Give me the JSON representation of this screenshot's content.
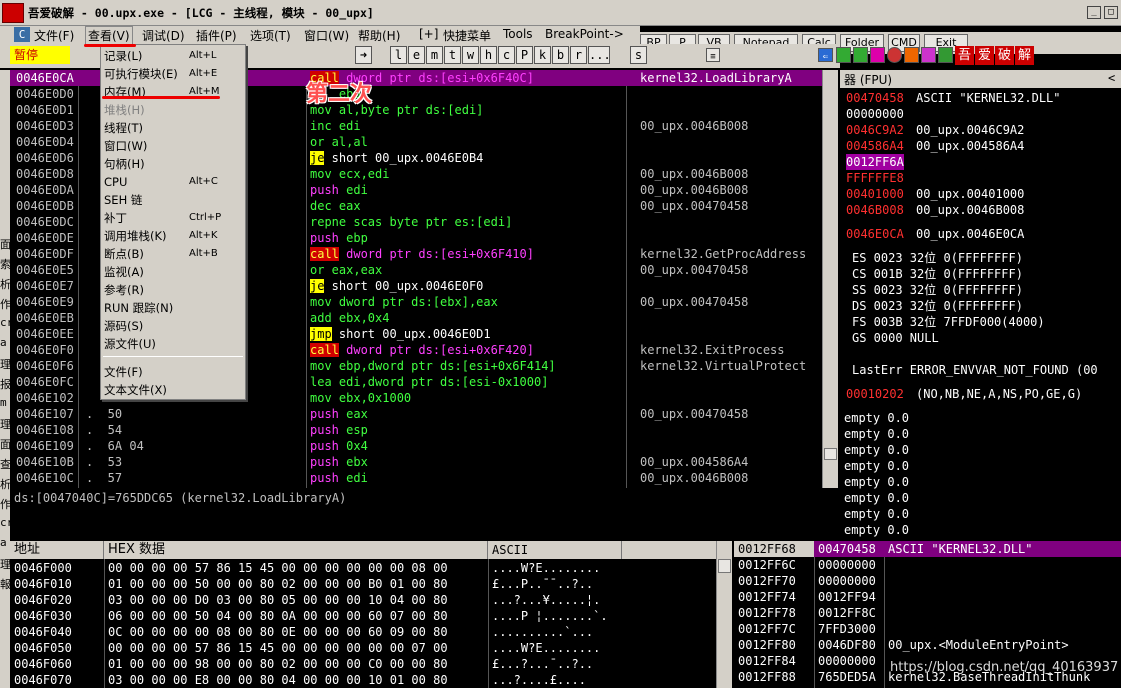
{
  "window": {
    "title": "吾爱破解 - 00.upx.exe - [LCG - 主线程, 模块 - 00_upx]"
  },
  "menubar": {
    "items": [
      "文件(F)",
      "查看(V)",
      "调试(D)",
      "插件(P)",
      "选项(T)",
      "窗口(W)",
      "帮助(H)",
      "[+]",
      "快捷菜单",
      "Tools",
      "BreakPoint->"
    ]
  },
  "toolbar": {
    "letters": [
      "l",
      "e",
      "m",
      "t",
      "w",
      "h",
      "c",
      "P",
      "k",
      "b",
      "r",
      "...",
      "s"
    ]
  },
  "right_buttons": [
    "BP",
    "P",
    "VB",
    "Notepad",
    "Calc",
    "Folder",
    "CMD",
    "Exit"
  ],
  "brand_chars": [
    "吾",
    "爱",
    "破",
    "解"
  ],
  "status": {
    "paused": "暂停"
  },
  "annotation": "第二次",
  "view_menu": [
    {
      "label": "记录(L)",
      "shortcut": "Alt+L"
    },
    {
      "label": "可执行模块(E)",
      "shortcut": "Alt+E"
    },
    {
      "label": "内存(M)",
      "shortcut": "Alt+M"
    },
    {
      "label": "堆栈(H)",
      "shortcut": "",
      "disabled": true
    },
    {
      "label": "线程(T)",
      "shortcut": ""
    },
    {
      "label": "窗口(W)",
      "shortcut": ""
    },
    {
      "label": "句柄(H)",
      "shortcut": ""
    },
    {
      "label": "CPU",
      "shortcut": "Alt+C"
    },
    {
      "label": "SEH 链",
      "shortcut": ""
    },
    {
      "label": "补丁",
      "shortcut": "Ctrl+P"
    },
    {
      "label": "调用堆栈(K)",
      "shortcut": "Alt+K"
    },
    {
      "label": "断点(B)",
      "shortcut": "Alt+B"
    },
    {
      "label": "监视(A)",
      "shortcut": ""
    },
    {
      "label": "参考(R)",
      "shortcut": ""
    },
    {
      "label": "RUN 跟踪(N)",
      "shortcut": ""
    },
    {
      "label": "源码(S)",
      "shortcut": ""
    },
    {
      "label": "源文件(U)",
      "shortcut": ""
    },
    {
      "label": "文件(F)",
      "shortcut": ""
    },
    {
      "label": "文本文件(X)",
      "shortcut": ""
    }
  ],
  "disasm": [
    {
      "addr": "0046E0CA",
      "hex": "",
      "asm": "call dword ptr ds:[esi+0x6F40C]",
      "comment": "kernel32.LoadLibraryA",
      "hl": true
    },
    {
      "addr": "0046E0D0",
      "hex": "",
      "asm": "    ebp",
      "comment": ""
    },
    {
      "addr": "0046E0D1",
      "hex": "",
      "asm": "mov al,byte ptr ds:[edi]",
      "comment": ""
    },
    {
      "addr": "0046E0D3",
      "hex": "",
      "asm": "inc edi",
      "comment": "00_upx.0046B008"
    },
    {
      "addr": "0046E0D4",
      "hex": "",
      "asm": "or al,al",
      "comment": ""
    },
    {
      "addr": "0046E0D6",
      "hex": "",
      "asm": "je short 00_upx.0046E0B4",
      "comment": ""
    },
    {
      "addr": "0046E0D8",
      "hex": "",
      "asm": "mov ecx,edi",
      "comment": "00_upx.0046B008"
    },
    {
      "addr": "0046E0DA",
      "hex": "",
      "asm": "push edi",
      "comment": "00_upx.0046B008"
    },
    {
      "addr": "0046E0DB",
      "hex": "",
      "asm": "dec eax",
      "comment": "00_upx.00470458"
    },
    {
      "addr": "0046E0DC",
      "hex": "",
      "asm": "repne scas byte ptr es:[edi]",
      "comment": ""
    },
    {
      "addr": "0046E0DE",
      "hex": "",
      "asm": "push ebp",
      "comment": ""
    },
    {
      "addr": "0046E0DF",
      "hex": "",
      "asm": "call dword ptr ds:[esi+0x6F410]",
      "comment": "kernel32.GetProcAddress"
    },
    {
      "addr": "0046E0E5",
      "hex": "",
      "asm": "or eax,eax",
      "comment": "00_upx.00470458"
    },
    {
      "addr": "0046E0E7",
      "hex": "",
      "asm": "je short 00_upx.0046E0F0",
      "comment": ""
    },
    {
      "addr": "0046E0E9",
      "hex": "",
      "asm": "mov dword ptr ds:[ebx],eax",
      "comment": "00_upx.00470458"
    },
    {
      "addr": "0046E0EB",
      "hex": "",
      "asm": "add ebx,0x4",
      "comment": ""
    },
    {
      "addr": "0046E0EE",
      "hex": "",
      "asm": "jmp short 00_upx.0046E0D1",
      "comment": ""
    },
    {
      "addr": "0046E0F0",
      "hex": "",
      "asm": "call dword ptr ds:[esi+0x6F420]",
      "comment": "kernel32.ExitProcess"
    },
    {
      "addr": "0046E0F6",
      "hex": "",
      "asm": "mov ebp,dword ptr ds:[esi+0x6F414]",
      "comment": "kernel32.VirtualProtect"
    },
    {
      "addr": "0046E0FC",
      "hex": "",
      "asm": "lea edi,dword ptr ds:[esi-0x1000]",
      "comment": ""
    },
    {
      "addr": "0046E102",
      "hex": "",
      "asm": "mov ebx,0x1000",
      "comment": ""
    },
    {
      "addr": "0046E107",
      "hex": ".  50",
      "asm": "push eax",
      "comment": "00_upx.00470458"
    },
    {
      "addr": "0046E108",
      "hex": ".  54",
      "asm": "push esp",
      "comment": ""
    },
    {
      "addr": "0046E109",
      "hex": ".  6A 04",
      "asm": "push 0x4",
      "comment": ""
    },
    {
      "addr": "0046E10B",
      "hex": ".  53",
      "asm": "push ebx",
      "comment": "00_upx.004586A4"
    },
    {
      "addr": "0046E10C",
      "hex": ".  57",
      "asm": "push edi",
      "comment": "00_upx.0046B008"
    }
  ],
  "info_line": "ds:[0047040C]=765DDC65 (kernel32.LoadLibraryA)",
  "regs_header": "器 (FPU)",
  "regs": [
    {
      "a": "00470458",
      "b": "ASCII \"KERNEL32.DLL\"",
      "c": "red"
    },
    {
      "a": "00000000",
      "b": "",
      "c": "white"
    },
    {
      "a": "0046C9A2",
      "b": "00_upx.0046C9A2",
      "c": "red"
    },
    {
      "a": "004586A4",
      "b": "00_upx.004586A4",
      "c": "red"
    },
    {
      "a": "0012FF6A",
      "b": "",
      "c": "hl"
    },
    {
      "a": "FFFFFFE8",
      "b": "",
      "c": "red"
    },
    {
      "a": "00401000",
      "b": "00_upx.00401000",
      "c": "red"
    },
    {
      "a": "0046B008",
      "b": "00_upx.0046B008",
      "c": "red"
    }
  ],
  "eip": {
    "a": "0046E0CA",
    "b": "00_upx.0046E0CA"
  },
  "segs": [
    "ES 0023 32位 0(FFFFFFFF)",
    "CS 001B 32位 0(FFFFFFFF)",
    "SS 0023 32位 0(FFFFFFFF)",
    "DS 0023 32位 0(FFFFFFFF)",
    "FS 003B 32位 7FFDF000(4000)",
    "GS 0000 NULL"
  ],
  "lasterr": "LastErr ERROR_ENVVAR_NOT_FOUND (00",
  "eflags": {
    "a": "00010202",
    "b": "(NO,NB,NE,A,NS,PO,GE,G)"
  },
  "fpu": [
    "empty 0.0",
    "empty 0.0",
    "empty 0.0",
    "empty 0.0",
    "empty 0.0",
    "empty 0.0",
    "empty 0.0",
    "empty 0.0"
  ],
  "dump_headers": [
    "地址",
    "HEX 数据",
    "ASCII"
  ],
  "dump": [
    {
      "addr": "0046F000",
      "hex": "00 00 00 00 57 86 15 45 00 00 00 00 00 00 08 00",
      "ascii": "....W?E........"
    },
    {
      "addr": "0046F010",
      "hex": "01 00 00 00 50 00 00 80 02 00 00 00 B0 01 00 80",
      "ascii": "£...P..¯¯..?.."
    },
    {
      "addr": "0046F020",
      "hex": "03 00 00 00 D0 03 00 80 05 00 00 00 10 04 00 80",
      "ascii": "...?...¥.....¦."
    },
    {
      "addr": "0046F030",
      "hex": "06 00 00 00 50 04 00 80 0A 00 00 00 60 07 00 80",
      "ascii": "....P ¦.......`."
    },
    {
      "addr": "0046F040",
      "hex": "0C 00 00 00 00 08 00 80 0E 00 00 00 60 09 00 80",
      "ascii": "..........`..."
    },
    {
      "addr": "0046F050",
      "hex": "00 00 00 00 57 86 15 45 00 00 00 00 00 00 07 00",
      "ascii": "....W?E........"
    },
    {
      "addr": "0046F060",
      "hex": "01 00 00 00 98 00 00 80 02 00 00 00 C0 00 00 80",
      "ascii": "£...?...¯..?.."
    },
    {
      "addr": "0046F070",
      "hex": "03 00 00 00 E8 00 00 80 04 00 00 00 10 01 00 80",
      "ascii": "...?....£...."
    }
  ],
  "stack": [
    {
      "a": "0012FF68",
      "b": "00470458",
      "c": "ASCII \"KERNEL32.DLL\"",
      "hl": true
    },
    {
      "a": "0012FF6C",
      "b": "00000000",
      "c": ""
    },
    {
      "a": "0012FF70",
      "b": "00000000",
      "c": ""
    },
    {
      "a": "0012FF74",
      "b": "0012FF94",
      "c": ""
    },
    {
      "a": "0012FF78",
      "b": "0012FF8C",
      "c": ""
    },
    {
      "a": "0012FF7C",
      "b": "7FFD3000",
      "c": ""
    },
    {
      "a": "0012FF80",
      "b": "0046DF80",
      "c": "00_upx.<ModuleEntryPoint>"
    },
    {
      "a": "0012FF84",
      "b": "00000000",
      "c": ""
    },
    {
      "a": "0012FF88",
      "b": "765DED5A",
      "c": "kernel32.BaseThreadInitThunk"
    }
  ],
  "watermark": "https://blog.csdn.net/qq_40163937",
  "left_strip_chars": [
    "面",
    "索",
    "析",
    "作",
    "cr",
    "a",
    "理",
    "报",
    "m",
    "理",
    "面",
    "查",
    "析",
    "作",
    "cr",
    "a",
    "理",
    "報"
  ]
}
